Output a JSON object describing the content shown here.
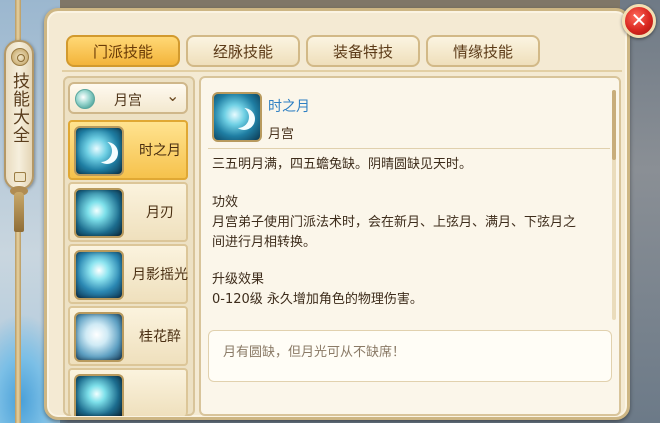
{
  "side_tab": {
    "title": "技能大全"
  },
  "tabs": [
    {
      "label": "门派技能",
      "active": true
    },
    {
      "label": "经脉技能",
      "active": false
    },
    {
      "label": "装备特技",
      "active": false
    },
    {
      "label": "情缘技能",
      "active": false
    }
  ],
  "school_select": {
    "value": "月宫",
    "icon": "moon-palace-emblem-icon"
  },
  "skills": [
    {
      "name": "时之月",
      "icon": "moon-time-skill-icon",
      "selected": true
    },
    {
      "name": "月刃",
      "icon": "moon-blade-skill-icon",
      "selected": false
    },
    {
      "name": "月影摇光",
      "icon": "moon-shadow-skill-icon",
      "selected": false
    },
    {
      "name": "桂花醉",
      "icon": "osmanthus-skill-icon",
      "selected": false
    }
  ],
  "detail": {
    "name": "时之月",
    "school": "月宫",
    "poem": "三五明月满，四五蟾兔缺。阴晴圆缺见天时。",
    "effect_title": "功效",
    "effect_line1": "月宫弟子使用门派法术时，会在新月、上弦月、满月、下弦月之",
    "effect_line2": "间进行月相转换。",
    "upgrade_title": "升级效果",
    "upgrade_text": "0-120级  永久增加角色的物理伤害。",
    "flavor": "月有圆缺，但月光可从不缺席！"
  },
  "colors": {
    "active_tab": "#f3b43a",
    "skill_name_link": "#2d7fc3",
    "close_button": "#d8261f"
  }
}
